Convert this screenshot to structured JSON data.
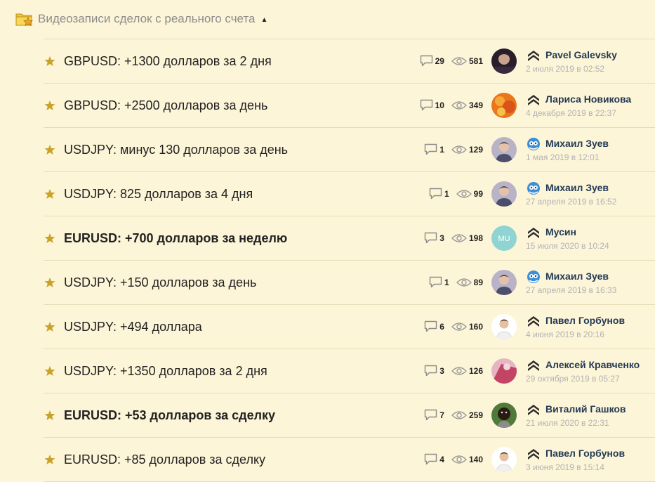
{
  "section": {
    "title": "Видеозаписи сделок с реального счета",
    "folder_icon": "folder-star-icon",
    "toggle_icon": "caret-up-icon"
  },
  "colors": {
    "background": "#fdf5d8",
    "divider": "#e7dcb8",
    "star": "#c9a227",
    "author": "#233a55",
    "date": "#b2b2b2"
  },
  "threads": [
    {
      "title": "GBPUSD: +1300 долларов за 2 дня",
      "bold": false,
      "comments": "29",
      "views": "581",
      "author": "Pavel Galevsky",
      "date": "2 июля 2019 в 02:52",
      "rank_icon": "chevron-rank-icon",
      "avatar": "photo-dark"
    },
    {
      "title": "GBPUSD: +2500 долларов за день",
      "bold": false,
      "comments": "10",
      "views": "349",
      "author": "Лариса Новикова",
      "date": "4 декабря 2019 в 22:37",
      "rank_icon": "chevron-rank-icon",
      "avatar": "photo-orange"
    },
    {
      "title": "USDJPY: минус 130 долларов за день",
      "bold": false,
      "comments": "1",
      "views": "129",
      "author": "Михаил Зуев",
      "date": "1 мая 2019 в 12:01",
      "rank_icon": "owl-rank-icon",
      "avatar": "photo-man"
    },
    {
      "title": "USDJPY: 825 долларов за 4 дня",
      "bold": false,
      "comments": "1",
      "views": "99",
      "author": "Михаил Зуев",
      "date": "27 апреля 2019 в 16:52",
      "rank_icon": "owl-rank-icon",
      "avatar": "photo-man"
    },
    {
      "title": "EURUSD: +700 долларов за неделю",
      "bold": true,
      "comments": "3",
      "views": "198",
      "author": "Мусин",
      "date": "15 июля 2020 в 10:24",
      "rank_icon": "chevron-rank-icon",
      "avatar": "initials",
      "initials": "MU"
    },
    {
      "title": "USDJPY: +150 долларов за день",
      "bold": false,
      "comments": "1",
      "views": "89",
      "author": "Михаил Зуев",
      "date": "27 апреля 2019 в 16:33",
      "rank_icon": "owl-rank-icon",
      "avatar": "photo-man"
    },
    {
      "title": "USDJPY: +494 доллара",
      "bold": false,
      "comments": "6",
      "views": "160",
      "author": "Павел Горбунов",
      "date": "4 июня 2019 в 20:16",
      "rank_icon": "chevron-rank-icon",
      "avatar": "photo-white"
    },
    {
      "title": "USDJPY: +1350 долларов за 2 дня",
      "bold": false,
      "comments": "3",
      "views": "126",
      "author": "Алексей Кравченко",
      "date": "29 октября 2019 в 05:27",
      "rank_icon": "chevron-rank-icon",
      "avatar": "photo-pink"
    },
    {
      "title": "EURUSD: +53 долларов за сделку",
      "bold": true,
      "comments": "7",
      "views": "259",
      "author": "Виталий Гашков",
      "date": "21 июля 2020 в 22:31",
      "rank_icon": "chevron-rank-icon",
      "avatar": "photo-green"
    },
    {
      "title": "EURUSD: +85 долларов за сделку",
      "bold": false,
      "comments": "4",
      "views": "140",
      "author": "Павел Горбунов",
      "date": "3 июня 2019 в 15:14",
      "rank_icon": "chevron-rank-icon",
      "avatar": "photo-white"
    }
  ]
}
